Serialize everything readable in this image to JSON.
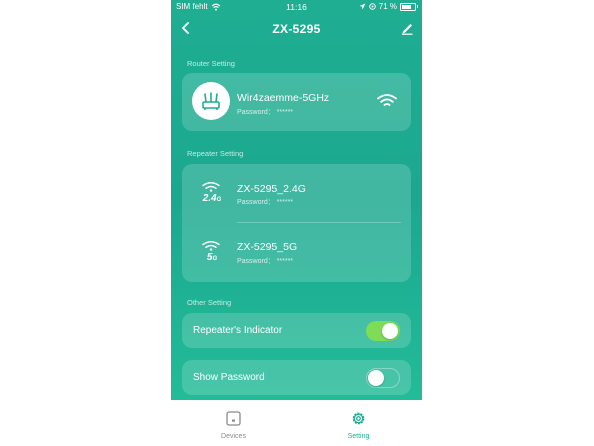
{
  "status_bar": {
    "carrier": "SIM fehlt",
    "time": "11:16",
    "battery": "71 %",
    "battery_level": 0.71
  },
  "nav": {
    "title": "ZX-5295"
  },
  "router_section": {
    "label": "Router Setting",
    "network": {
      "name": "Wir4zaemme-5GHz",
      "password": "Password： ******"
    }
  },
  "repeater_section": {
    "label": "Repeater Setting",
    "networks": [
      {
        "band": "2.4",
        "band_unit": "G",
        "name": "ZX-5295_2.4G",
        "password": "Password： ******"
      },
      {
        "band": "5",
        "band_unit": "G",
        "name": "ZX-5295_5G",
        "password": "Password： ******"
      }
    ]
  },
  "other_section": {
    "label": "Other Setting",
    "toggles": [
      {
        "label": "Repeater's Indicator",
        "on": true
      },
      {
        "label": "Show Password",
        "on": false
      }
    ]
  },
  "tabs": [
    {
      "label": "Devices",
      "icon": "devices-icon",
      "active": false
    },
    {
      "label": "Setting",
      "icon": "gear-icon",
      "active": true
    }
  ],
  "colors": {
    "accent": "#1fae92",
    "tab_active": "#1fae92",
    "tab_inactive": "#8a8a8a",
    "toggle_on": "#7edc57"
  }
}
